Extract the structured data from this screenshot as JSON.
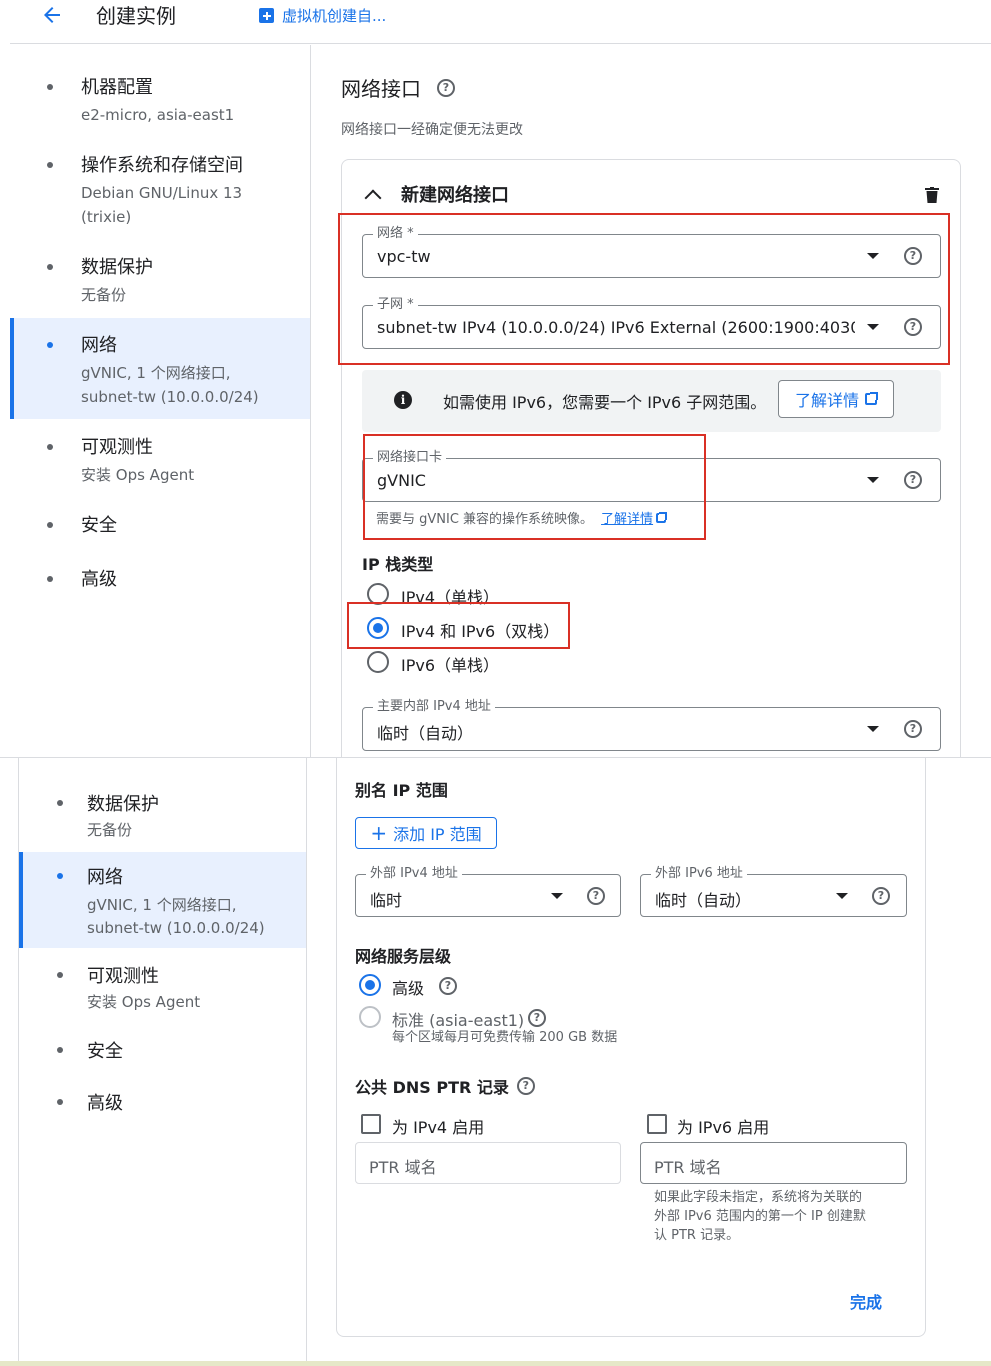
{
  "header": {
    "title": "创建实例",
    "doc_link": "虚拟机创建自..."
  },
  "sidebar_top": [
    {
      "title": "机器配置",
      "sub": [
        "e2-micro, asia-east1"
      ]
    },
    {
      "title": "操作系统和存储空间",
      "sub": [
        "Debian GNU/Linux 13",
        "(trixie)"
      ]
    },
    {
      "title": "数据保护",
      "sub": [
        "无备份"
      ]
    },
    {
      "title": "网络",
      "sub": [
        "gVNIC, 1 个网络接口,",
        "subnet-tw (10.0.0.0/24)"
      ]
    },
    {
      "title": "可观测性",
      "sub": [
        "安装 Ops Agent"
      ]
    },
    {
      "title": "安全",
      "sub": []
    },
    {
      "title": "高级",
      "sub": []
    }
  ],
  "sidebar_bottom": [
    {
      "title": "数据保护",
      "sub": [
        "无备份"
      ]
    },
    {
      "title": "网络",
      "sub": [
        "gVNIC, 1 个网络接口,",
        "subnet-tw (10.0.0.0/24)"
      ]
    },
    {
      "title": "可观测性",
      "sub": [
        "安装 Ops Agent"
      ]
    },
    {
      "title": "安全",
      "sub": []
    },
    {
      "title": "高级",
      "sub": []
    }
  ],
  "network_interface": {
    "heading": "网络接口",
    "subtitle": "网络接口一经确定便无法更改",
    "card_title": "新建网络接口",
    "network": {
      "label": "网络 *",
      "value": "vpc-tw"
    },
    "subnet": {
      "label": "子网 *",
      "value": "subnet-tw IPv4 (10.0.0.0/24)  IPv6 External (2600:1900:4030:..."
    },
    "info_text": "如需使用 IPv6，您需要一个 IPv6 子网范围。",
    "info_button": "了解详情",
    "nic": {
      "label": "网络接口卡",
      "value": "gVNIC",
      "hint": "需要与 gVNIC 兼容的操作系统映像。",
      "hint_link": "了解详情"
    },
    "ip_stack_title": "IP 栈类型",
    "ip_stack_options": [
      "IPv4（单栈）",
      "IPv4 和 IPv6（双栈）",
      "IPv6（单栈）"
    ],
    "ip_stack_selected": 1,
    "primary_ipv4": {
      "label": "主要内部 IPv4 地址",
      "value": "临时（自动）"
    },
    "alias_title": "别名 IP 范围",
    "add_range_button": "添加 IP 范围",
    "ext_ipv4": {
      "label": "外部 IPv4 地址",
      "value": "临时"
    },
    "ext_ipv6": {
      "label": "外部 IPv6 地址",
      "value": "临时（自动）"
    },
    "tier_title": "网络服务层级",
    "tier_premium": "高级",
    "tier_standard": "标准 (asia-east1)",
    "tier_standard_hint": "每个区域每月可免费传输 200 GB 数据",
    "dns_title": "公共 DNS PTR 记录",
    "ipv4_enable": "为 IPv4 启用",
    "ipv6_enable": "为 IPv6 启用",
    "ptr_placeholder": "PTR 域名",
    "ipv6_hint": [
      "如果此字段未指定，系统将为关联的",
      "外部 IPv6 范围内的第一个 IP 创建默",
      "认 PTR 记录。"
    ],
    "done_button": "完成"
  },
  "colors": {
    "accent": "#1a73e8",
    "highlight": "#d93025",
    "active_bg": "#e8f0fe"
  }
}
